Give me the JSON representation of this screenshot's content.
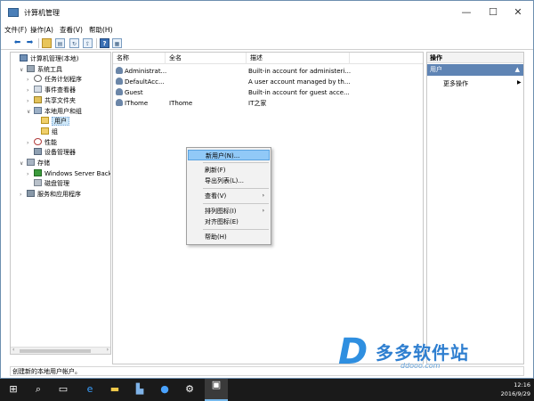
{
  "window": {
    "title": "计算机管理"
  },
  "menubar": [
    "文件(F)",
    "操作(A)",
    "查看(V)",
    "帮助(H)"
  ],
  "tree": [
    {
      "label": "计算机管理(本地)",
      "icon": "computer-icon",
      "indent": 0,
      "expander": ""
    },
    {
      "label": "系统工具",
      "icon": "tools-icon",
      "indent": 1,
      "expander": "v"
    },
    {
      "label": "任务计划程序",
      "icon": "clock-icon",
      "indent": 2,
      "expander": ">"
    },
    {
      "label": "事件查看器",
      "icon": "event-log-icon",
      "indent": 2,
      "expander": ">"
    },
    {
      "label": "共享文件夹",
      "icon": "shared-folder-icon",
      "indent": 2,
      "expander": ">"
    },
    {
      "label": "本地用户和组",
      "icon": "users-icon",
      "indent": 2,
      "expander": "v"
    },
    {
      "label": "用户",
      "icon": "folder-icon",
      "indent": 3,
      "expander": "",
      "selected": true
    },
    {
      "label": "组",
      "icon": "folder-icon",
      "indent": 3,
      "expander": ""
    },
    {
      "label": "性能",
      "icon": "performance-icon",
      "indent": 2,
      "expander": ">"
    },
    {
      "label": "设备管理器",
      "icon": "device-manager-icon",
      "indent": 2,
      "expander": ""
    },
    {
      "label": "存储",
      "icon": "storage-icon",
      "indent": 1,
      "expander": "v"
    },
    {
      "label": "Windows Server Back",
      "icon": "backup-icon",
      "indent": 2,
      "expander": ">"
    },
    {
      "label": "磁盘管理",
      "icon": "disk-icon",
      "indent": 2,
      "expander": ""
    },
    {
      "label": "服务和应用程序",
      "icon": "services-icon",
      "indent": 1,
      "expander": ">"
    }
  ],
  "list": {
    "columns": [
      "名称",
      "全名",
      "描述"
    ],
    "rows": [
      {
        "name": "Administrat...",
        "fullname": "",
        "desc": "Built-in account for administeri..."
      },
      {
        "name": "DefaultAcc...",
        "fullname": "",
        "desc": "A user account managed by th..."
      },
      {
        "name": "Guest",
        "fullname": "",
        "desc": "Built-in account for guest acce..."
      },
      {
        "name": "IThome",
        "fullname": "IThome",
        "desc": "IT之家"
      }
    ]
  },
  "actions": {
    "title": "操作",
    "section": "用户",
    "item": "更多操作"
  },
  "context_menu": [
    {
      "label": "新用户(N)...",
      "highlighted": true,
      "submenu": false
    },
    {
      "sep": true
    },
    {
      "label": "刷新(F)",
      "submenu": false
    },
    {
      "label": "导出列表(L)...",
      "submenu": false
    },
    {
      "sep": true
    },
    {
      "label": "查看(V)",
      "submenu": true
    },
    {
      "sep": true
    },
    {
      "label": "排列图标(I)",
      "submenu": true
    },
    {
      "label": "对齐图标(E)",
      "submenu": false
    },
    {
      "sep": true
    },
    {
      "label": "帮助(H)",
      "submenu": false
    }
  ],
  "status": "创建新的本地用户帐户。",
  "watermark": {
    "brand": "多多软件站",
    "domain": "ddooo.com"
  },
  "taskbar": {
    "time": "12:16",
    "date": "2016/9/29"
  }
}
